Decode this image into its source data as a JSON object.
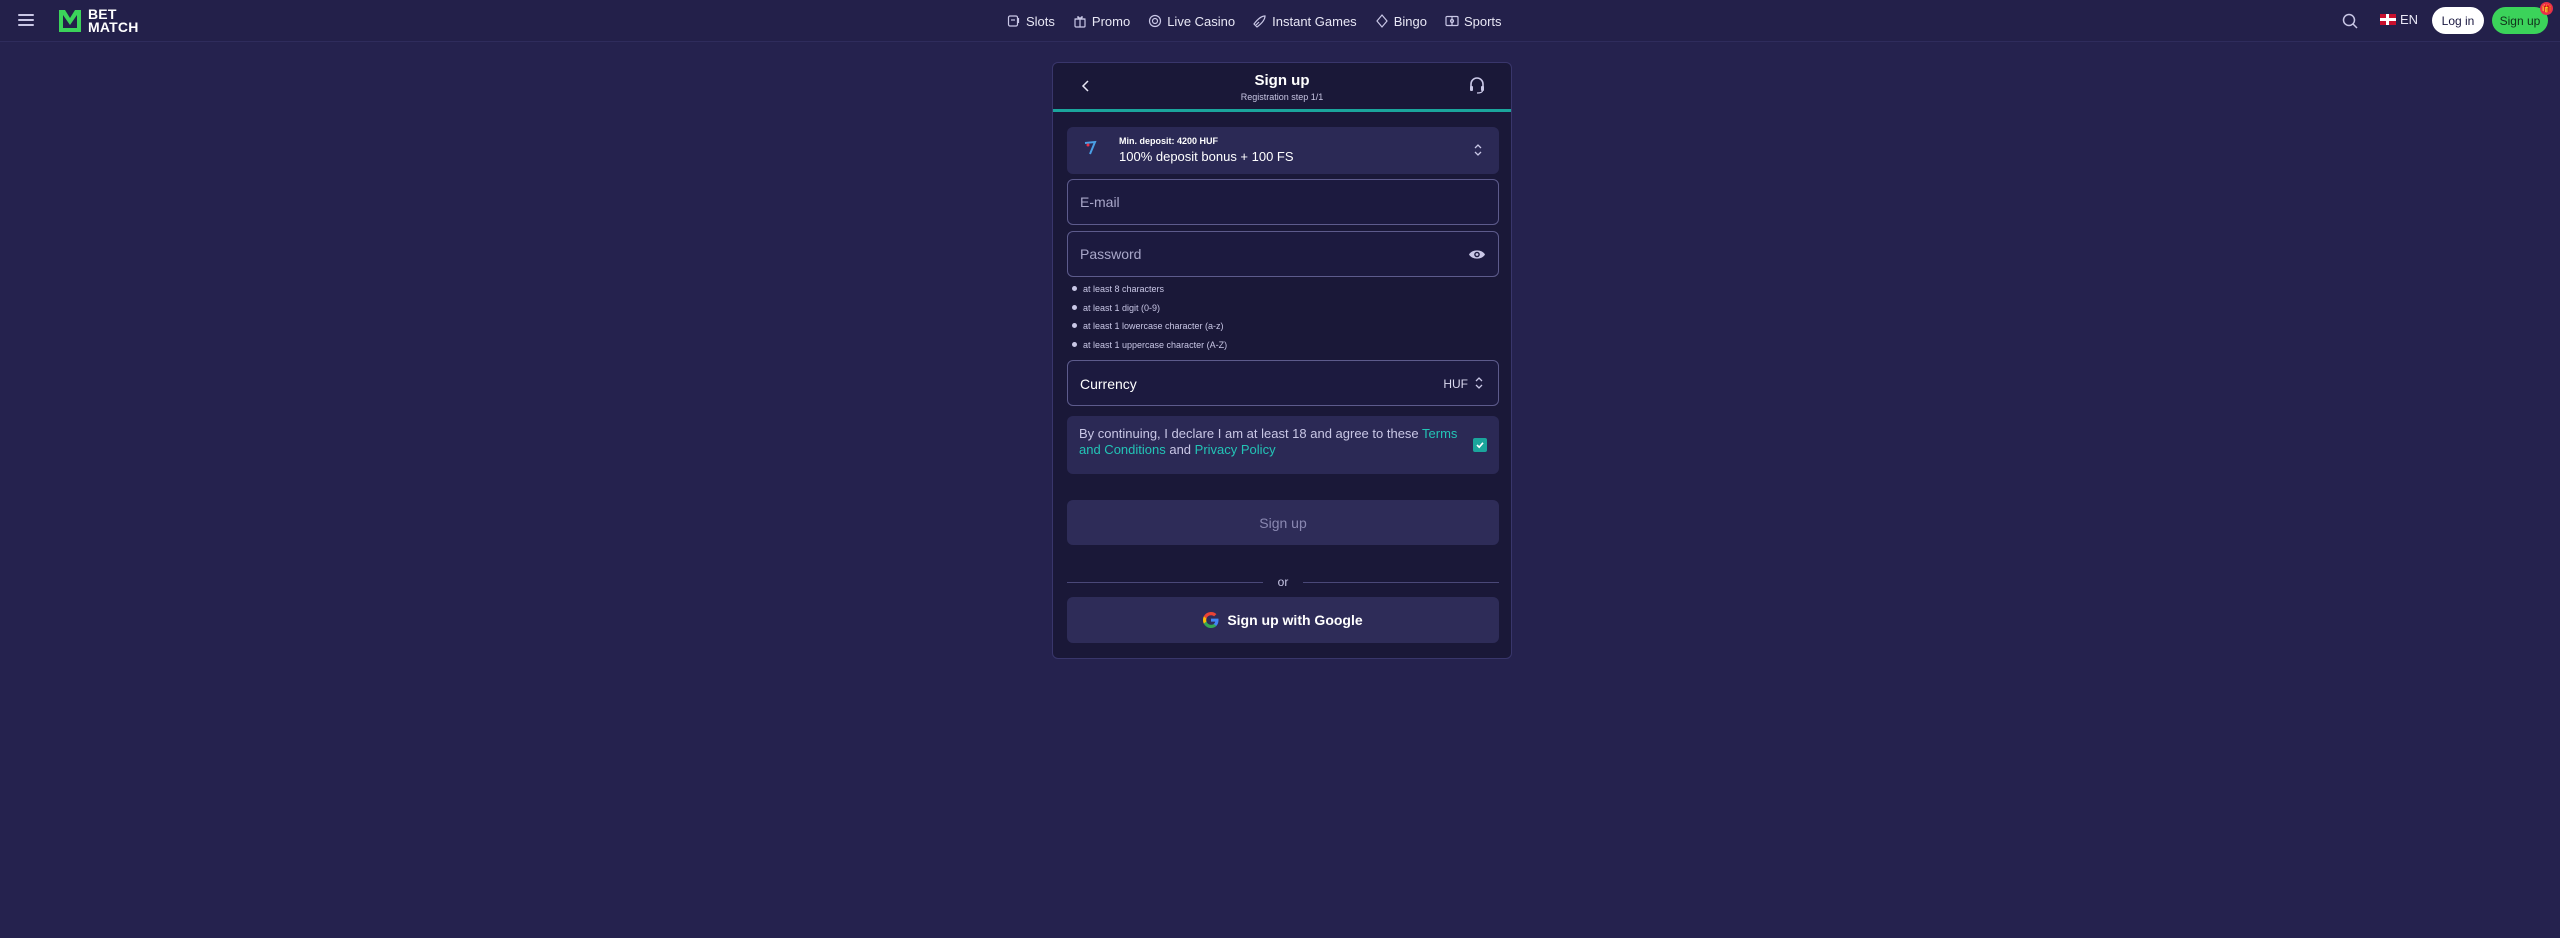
{
  "header": {
    "logo_line1": "BET",
    "logo_line2": "MATCH",
    "nav": [
      {
        "label": "Slots"
      },
      {
        "label": "Promo"
      },
      {
        "label": "Live Casino"
      },
      {
        "label": "Instant Games"
      },
      {
        "label": "Bingo"
      },
      {
        "label": "Sports"
      }
    ],
    "language": "EN",
    "login_label": "Log in",
    "signup_label": "Sign up",
    "gift_badge": "🎁"
  },
  "modal": {
    "title": "Sign up",
    "subtitle": "Registration step 1/1",
    "bonus": {
      "min_deposit": "Min. deposit: 4200 HUF",
      "title": "100% deposit bonus + 100 FS"
    },
    "email_placeholder": "E-mail",
    "password_placeholder": "Password",
    "password_rules": [
      "at least 8 characters",
      "at least 1 digit (0-9)",
      "at least 1 lowercase character (a-z)",
      "at least 1 uppercase character (A-Z)"
    ],
    "currency_label": "Currency",
    "currency_value": "HUF",
    "terms": {
      "prefix": "By continuing, I declare I am at least 18 and agree to these ",
      "terms_link": "Terms and Conditions",
      "middle": " and ",
      "privacy_link": "Privacy Policy",
      "checked": true
    },
    "signup_button": "Sign up",
    "or_text": "or",
    "google_button": "Sign up with Google"
  },
  "colors": {
    "background": "#25224e",
    "accent_teal": "#1ba59c",
    "signup_green": "#3bd35a",
    "link": "#23c4b6"
  }
}
